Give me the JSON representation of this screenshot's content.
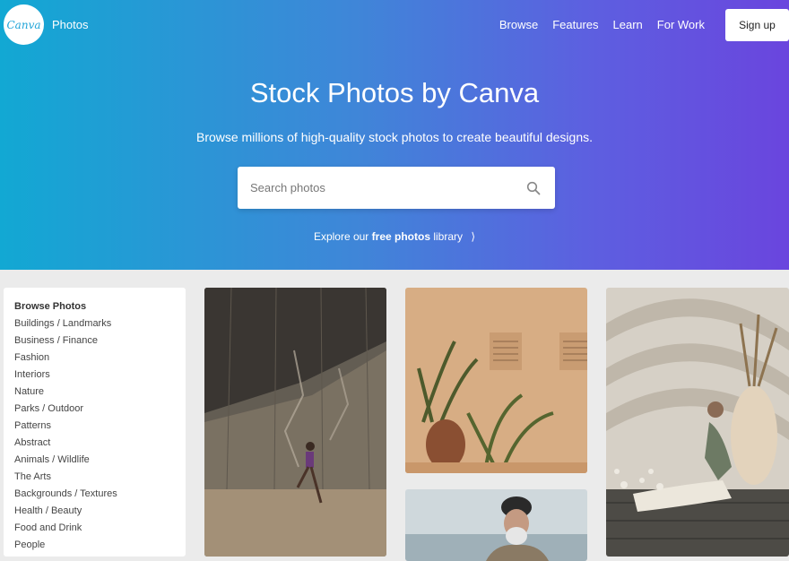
{
  "header": {
    "logo_text": "Canva",
    "brand_label": "Photos",
    "nav": [
      "Browse",
      "Features",
      "Learn",
      "For Work"
    ],
    "signup_label": "Sign up"
  },
  "hero": {
    "title": "Stock Photos by Canva",
    "subtitle": "Browse millions of high-quality stock photos to create beautiful designs.",
    "search_placeholder": "Search photos",
    "explore_prefix": "Explore our",
    "explore_bold": "free photos",
    "explore_suffix": "library",
    "explore_chevron": "⟩"
  },
  "sidebar": {
    "heading": "Browse Photos",
    "items": [
      "Buildings / Landmarks",
      "Business / Finance",
      "Fashion",
      "Interiors",
      "Nature",
      "Parks / Outdoor",
      "Patterns",
      "Abstract",
      "Animals / Wildlife",
      "The Arts",
      "Backgrounds / Textures",
      "Health / Beauty",
      "Food and Drink",
      "People"
    ]
  },
  "colors": {
    "gradient_start": "#12a8d3",
    "gradient_end": "#6a45de",
    "page_bg": "#ebebeb"
  }
}
